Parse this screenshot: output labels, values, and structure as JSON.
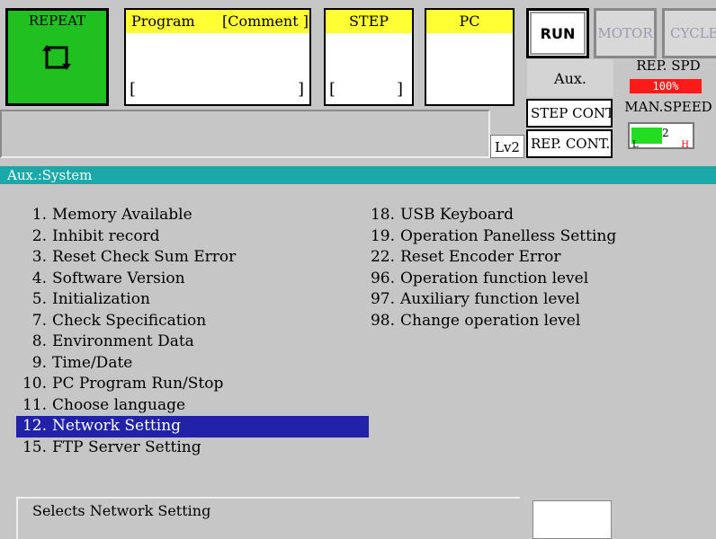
{
  "header": {
    "repeat_label": "REPEAT",
    "program_label": "Program",
    "comment_label": "[Comment ]",
    "program_value_open": "[",
    "program_value_close": "]",
    "step_label": "STEP",
    "step_value_open": "[",
    "step_value_close": "]",
    "pc_label": "PC",
    "run_label": "RUN",
    "motor_label": "MOTOR",
    "cycle_label": "CYCLE",
    "aux_label": "Aux.",
    "rep_spd_label": "REP. SPD",
    "rep_spd_value": "100%",
    "step_cont_label": "STEP CONT.",
    "rep_cont_label": "REP. CONT.",
    "level_label": "Lv2",
    "man_speed_label": "MAN.SPEED",
    "man_speed_value": "2",
    "man_speed_low": "L",
    "man_speed_high": "H"
  },
  "colors": {
    "repeat_bg": "#20c020",
    "header_yellow": "#ffff33",
    "title_bar": "#1aa8a8",
    "selected_bg": "#2222a8",
    "rep_spd_bar": "#ff1a1a"
  },
  "menu_title": "Aux.:System",
  "menu_left": [
    {
      "num": "1.",
      "label": "Memory Available"
    },
    {
      "num": "2.",
      "label": "Inhibit record"
    },
    {
      "num": "3.",
      "label": "Reset Check Sum Error"
    },
    {
      "num": "4.",
      "label": "Software Version"
    },
    {
      "num": "5.",
      "label": "Initialization"
    },
    {
      "num": "7.",
      "label": "Check Specification"
    },
    {
      "num": "8.",
      "label": "Environment Data"
    },
    {
      "num": "9.",
      "label": "Time/Date"
    },
    {
      "num": "10.",
      "label": "PC Program Run/Stop"
    },
    {
      "num": "11.",
      "label": "Choose language"
    },
    {
      "num": "12.",
      "label": "Network Setting"
    },
    {
      "num": "15.",
      "label": "FTP Server Setting"
    }
  ],
  "menu_right": [
    {
      "num": "18.",
      "label": "USB Keyboard"
    },
    {
      "num": "19.",
      "label": "Operation Panelless Setting"
    },
    {
      "num": "22.",
      "label": "Reset Encoder Error"
    },
    {
      "num": "96.",
      "label": "Operation function level"
    },
    {
      "num": "97.",
      "label": "Auxiliary function level"
    },
    {
      "num": "98.",
      "label": "Change operation level"
    }
  ],
  "selected_item": "12.",
  "help_text": "Selects Network Setting"
}
